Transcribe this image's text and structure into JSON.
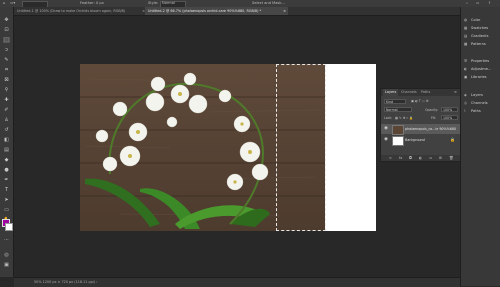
{
  "options_bar": {
    "feather_label": "Feather:",
    "feather_value": "0 px",
    "style_label": "Style:",
    "style_value": "Normal",
    "select_mask": "Select and Mask..."
  },
  "tabs": [
    {
      "label": "Untitled-1 @ 100% (Draw to make Orchids bloom again, RGB/8)",
      "close": "×"
    },
    {
      "label": "Untitled-2 @ 66.7% (phalaenopsis orchid-care 90%%680, RGB/8) *",
      "close": "×"
    }
  ],
  "canvas": {
    "bg_color": "#ffffff",
    "wood_color": "#5b4636"
  },
  "status_bar": {
    "text": "50%   1200 px × 720 px (118.11 ppi)  ›"
  },
  "right_dock": {
    "items": [
      {
        "label": "Color",
        "icon": "color-icon"
      },
      {
        "label": "Swatches",
        "icon": "swatches-icon"
      },
      {
        "label": "Gradients",
        "icon": "gradients-icon"
      },
      {
        "label": "Patterns",
        "icon": "patterns-icon"
      },
      {
        "label": "Properties",
        "icon": "properties-icon"
      },
      {
        "label": "Adjustme...",
        "icon": "adjustments-icon"
      },
      {
        "label": "Libraries",
        "icon": "libraries-icon"
      },
      {
        "label": "Layers",
        "icon": "layers-icon"
      },
      {
        "label": "Channels",
        "icon": "channels-icon"
      },
      {
        "label": "Paths",
        "icon": "paths-icon"
      }
    ]
  },
  "layers_panel": {
    "tabs": [
      "Layers",
      "Channels",
      "Paths"
    ],
    "kind_value": "Kind",
    "blend_value": "Normal",
    "opacity_label": "Opacity:",
    "opacity_value": "100%",
    "lock_label": "Lock:",
    "fill_label": "Fill:",
    "fill_value": "100%",
    "layers": [
      {
        "name": "phalaenopsis_ca...ie 90%%680",
        "selected": true
      },
      {
        "name": "Background",
        "selected": false
      }
    ]
  },
  "colors": {
    "foreground": "#a000a0",
    "background": "#ffffff",
    "accent": "#1473e6"
  }
}
